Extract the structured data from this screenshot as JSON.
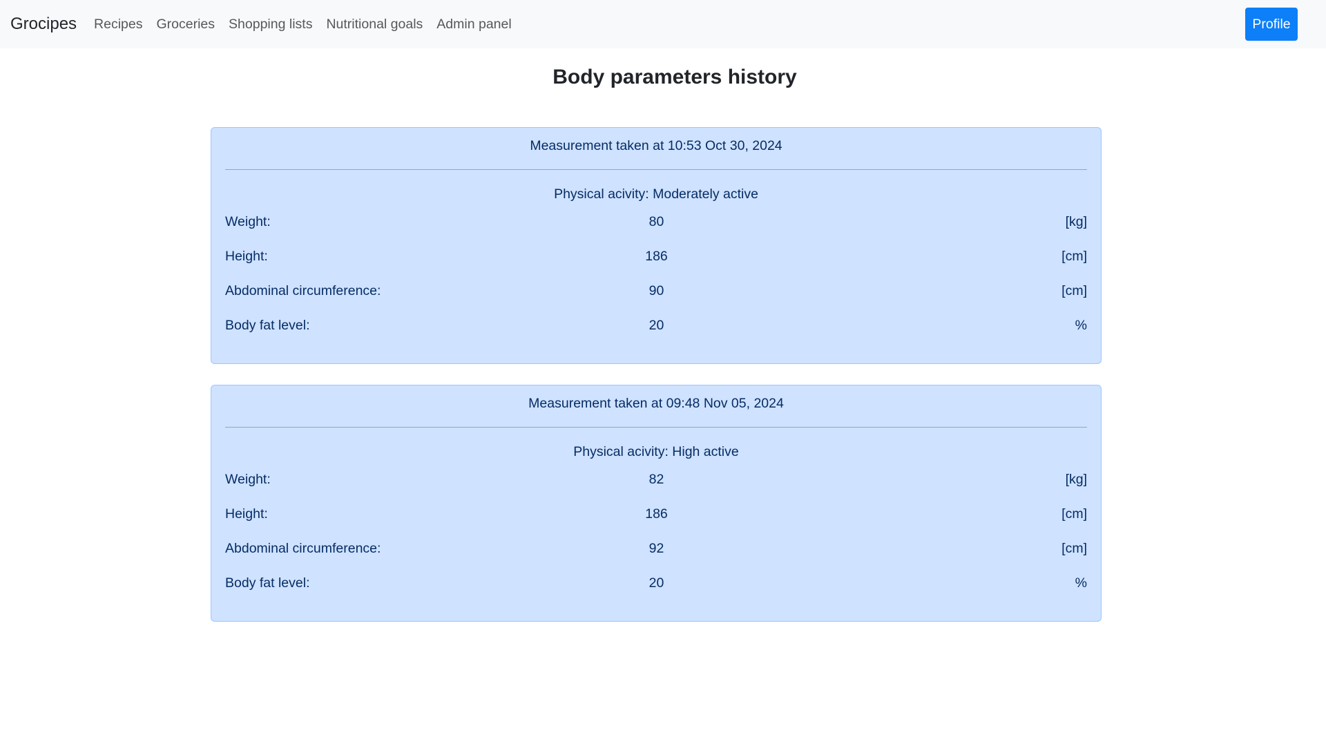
{
  "nav": {
    "brand": "Grocipes",
    "links": [
      "Recipes",
      "Groceries",
      "Shopping lists",
      "Nutritional goals",
      "Admin panel"
    ],
    "profile_label": "Profile"
  },
  "page_title": "Body parameters history",
  "measurements": [
    {
      "header": "Measurement taken at 10:53 Oct 30, 2024",
      "activity": "Physical acivity: Moderately active",
      "rows": [
        {
          "label": "Weight:",
          "value": "80",
          "unit": "[kg]"
        },
        {
          "label": "Height:",
          "value": "186",
          "unit": "[cm]"
        },
        {
          "label": "Abdominal circumference:",
          "value": "90",
          "unit": "[cm]"
        },
        {
          "label": "Body fat level:",
          "value": "20",
          "unit": "%"
        }
      ]
    },
    {
      "header": "Measurement taken at 09:48 Nov 05, 2024",
      "activity": "Physical acivity: High active",
      "rows": [
        {
          "label": "Weight:",
          "value": "82",
          "unit": "[kg]"
        },
        {
          "label": "Height:",
          "value": "186",
          "unit": "[cm]"
        },
        {
          "label": "Abdominal circumference:",
          "value": "92",
          "unit": "[cm]"
        },
        {
          "label": "Body fat level:",
          "value": "20",
          "unit": "%"
        }
      ]
    }
  ],
  "colors": {
    "navbar_bg": "#f8f9fa",
    "primary": "#0d7ff9",
    "card_bg": "#cfe2ff",
    "card_border": "#9ec5fe",
    "card_text": "#052c65"
  }
}
